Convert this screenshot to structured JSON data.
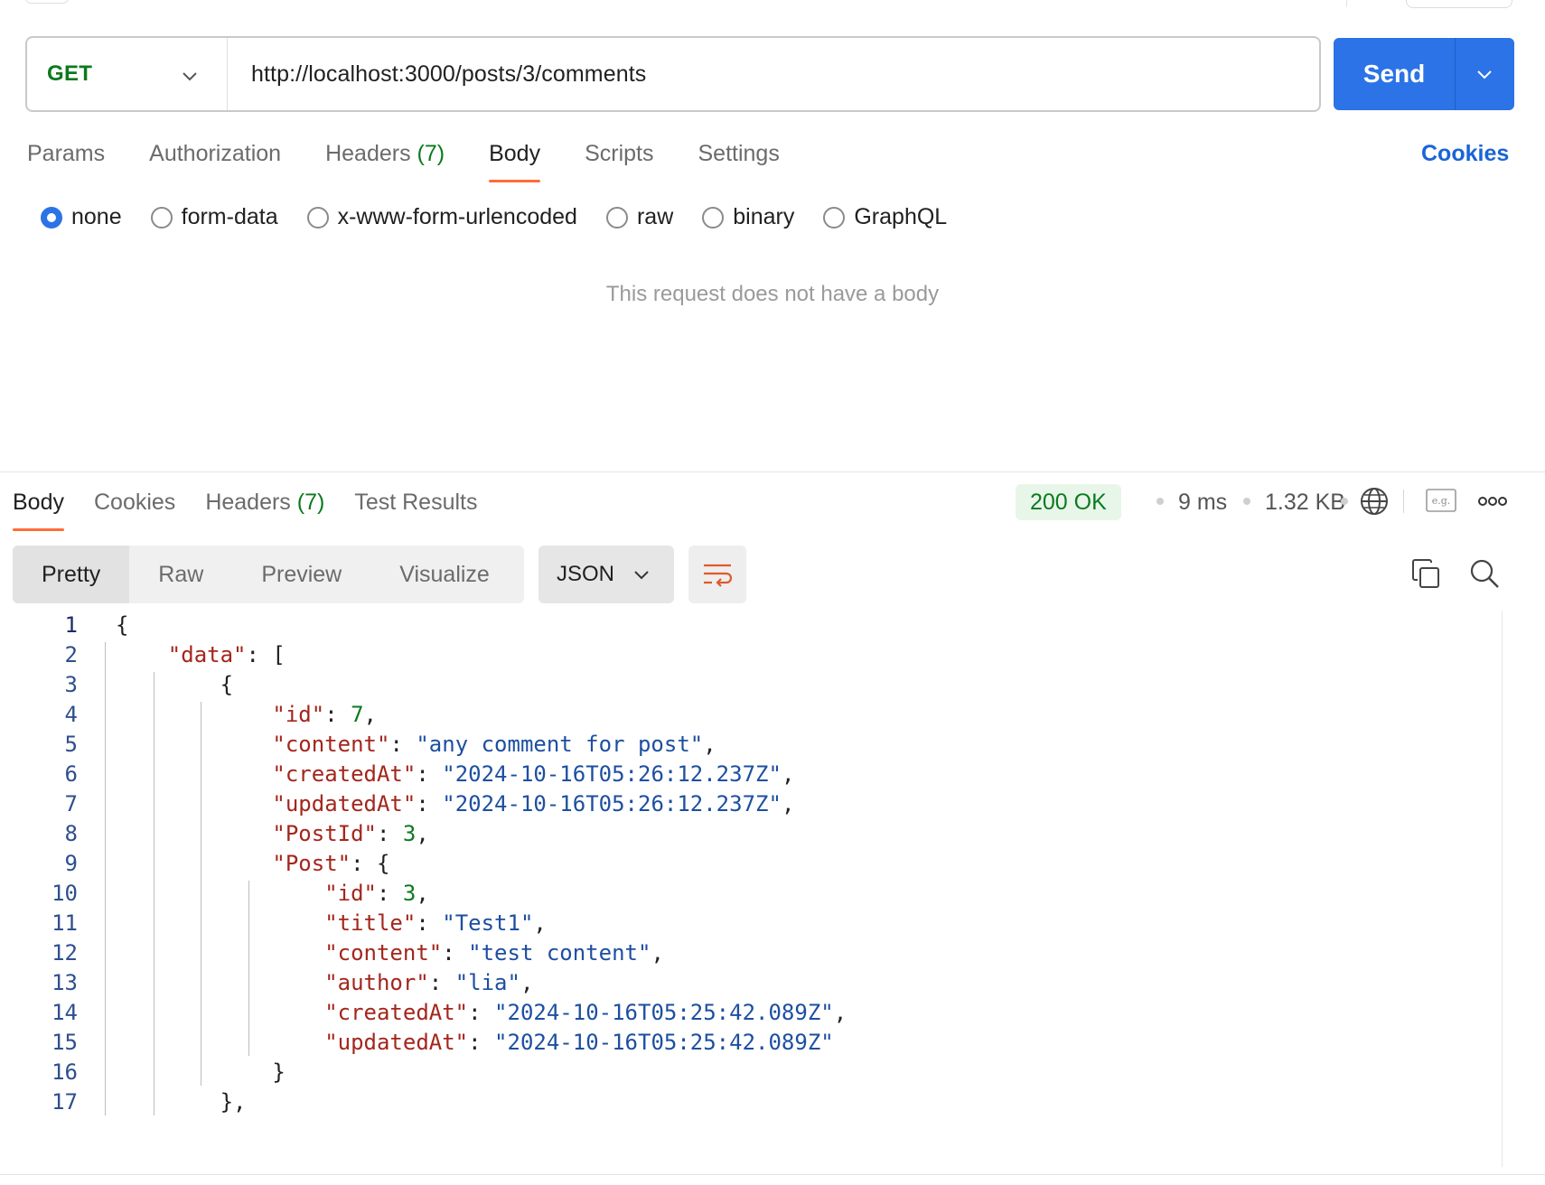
{
  "request": {
    "method": "GET",
    "url": "http://localhost:3000/posts/3/comments",
    "send_label": "Send",
    "tabs": [
      {
        "label": "Params",
        "count": ""
      },
      {
        "label": "Authorization",
        "count": ""
      },
      {
        "label": "Headers",
        "count": "(7)"
      },
      {
        "label": "Body",
        "count": ""
      },
      {
        "label": "Scripts",
        "count": ""
      },
      {
        "label": "Settings",
        "count": ""
      }
    ],
    "active_tab": "Body",
    "cookies_label": "Cookies",
    "body_types": [
      "none",
      "form-data",
      "x-www-form-urlencoded",
      "raw",
      "binary",
      "GraphQL"
    ],
    "selected_body_type": "none",
    "empty_body_message": "This request does not have a body"
  },
  "response": {
    "tabs": [
      {
        "label": "Body",
        "count": ""
      },
      {
        "label": "Cookies",
        "count": ""
      },
      {
        "label": "Headers",
        "count": "(7)"
      },
      {
        "label": "Test Results",
        "count": ""
      }
    ],
    "active_tab": "Body",
    "status": "200 OK",
    "time": "9 ms",
    "size": "1.32 KB",
    "view_modes": [
      "Pretty",
      "Raw",
      "Preview",
      "Visualize"
    ],
    "active_view": "Pretty",
    "format": "JSON",
    "code_lines": [
      "{",
      "    \"data\": [",
      "        {",
      "            \"id\": 7,",
      "            \"content\": \"any comment for post\",",
      "            \"createdAt\": \"2024-10-16T05:26:12.237Z\",",
      "            \"updatedAt\": \"2024-10-16T05:26:12.237Z\",",
      "            \"PostId\": 3,",
      "            \"Post\": {",
      "                \"id\": 3,",
      "                \"title\": \"Test1\",",
      "                \"content\": \"test content\",",
      "                \"author\": \"lia\",",
      "                \"createdAt\": \"2024-10-16T05:25:42.089Z\",",
      "                \"updatedAt\": \"2024-10-16T05:25:42.089Z\"",
      "            }",
      "        },"
    ]
  },
  "colors": {
    "accent": "#2b73e6",
    "tab_underline": "#ff6c37",
    "method_get": "#0b7a1e",
    "json_key": "#a3261c",
    "json_string": "#1d4fa0",
    "json_number": "#0b7a1e"
  },
  "icons": [
    "chevron-down-icon",
    "globe-icon",
    "example-icon",
    "more-icon",
    "wrap-lines-icon",
    "copy-icon",
    "search-icon"
  ]
}
